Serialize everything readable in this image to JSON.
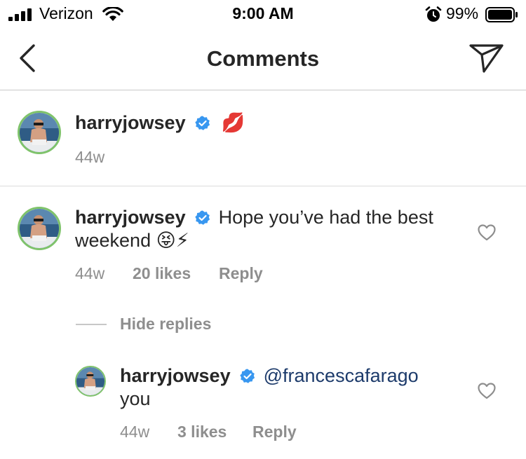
{
  "status_bar": {
    "carrier": "Verizon",
    "time": "9:00 AM",
    "battery": "99%"
  },
  "header": {
    "title": "Comments"
  },
  "caption": {
    "username": "harryjowsey",
    "text": "💋",
    "time": "44w"
  },
  "comments": [
    {
      "username": "harryjowsey",
      "text_line1": "Hope you’ve had the best",
      "text_line2": "weekend 😝⚡",
      "time": "44w",
      "likes": "20 likes",
      "reply_label": "Reply",
      "hide_replies_label": "Hide replies",
      "replies": [
        {
          "username": "harryjowsey",
          "mention": "@francescafarago",
          "text_line2": "you",
          "time": "44w",
          "likes": "3 likes",
          "reply_label": "Reply"
        }
      ]
    }
  ],
  "colors": {
    "text": "#262626",
    "meta": "#8e8e8e",
    "verified": "#3897f0",
    "mention": "#1d3b6b",
    "avatar_ring": "#7fc36b"
  },
  "icons": [
    "signal-icon",
    "wifi-icon",
    "alarm-icon",
    "battery-icon",
    "back-chevron-icon",
    "send-icon",
    "verified-badge-icon",
    "heart-icon"
  ]
}
